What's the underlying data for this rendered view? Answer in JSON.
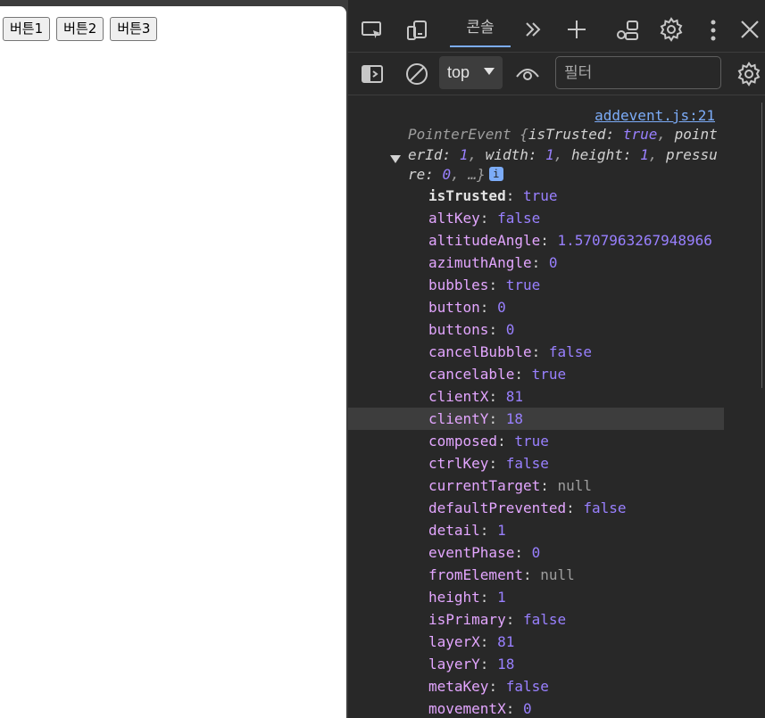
{
  "page": {
    "buttons": [
      {
        "label": "버튼1"
      },
      {
        "label": "버튼2"
      },
      {
        "label": "버튼3"
      }
    ]
  },
  "devtools": {
    "toolbar": {
      "icons": [
        "device-inspect-icon",
        "device-toggle-icon",
        "more-tabs-icon",
        "add-tab-icon",
        "feedback-icon",
        "settings-icon",
        "kebab-menu-icon",
        "close-icon"
      ],
      "active_tab": "콘솔"
    },
    "console_toolbar": {
      "context": "top",
      "filter_placeholder": "필터"
    },
    "console": {
      "source_link": "addevent.js:21",
      "summary": {
        "prefix": "PointerEvent {",
        "fields": [
          {
            "key": "isTrusted",
            "value": "true"
          },
          {
            "key": "pointerId",
            "value": "1"
          },
          {
            "key": "width",
            "value": "1"
          },
          {
            "key": "height",
            "value": "1"
          },
          {
            "key": "pressure",
            "value": "0"
          }
        ],
        "suffix": ", …}",
        "info_badge": "i"
      },
      "properties": [
        {
          "key": "isTrusted",
          "value": "true",
          "type": "bool",
          "own": true
        },
        {
          "key": "altKey",
          "value": "false",
          "type": "bool"
        },
        {
          "key": "altitudeAngle",
          "value": "1.5707963267948966",
          "type": "num"
        },
        {
          "key": "azimuthAngle",
          "value": "0",
          "type": "num"
        },
        {
          "key": "bubbles",
          "value": "true",
          "type": "bool"
        },
        {
          "key": "button",
          "value": "0",
          "type": "num"
        },
        {
          "key": "buttons",
          "value": "0",
          "type": "num"
        },
        {
          "key": "cancelBubble",
          "value": "false",
          "type": "bool"
        },
        {
          "key": "cancelable",
          "value": "true",
          "type": "bool"
        },
        {
          "key": "clientX",
          "value": "81",
          "type": "num"
        },
        {
          "key": "clientY",
          "value": "18",
          "type": "num",
          "highlighted": true
        },
        {
          "key": "composed",
          "value": "true",
          "type": "bool"
        },
        {
          "key": "ctrlKey",
          "value": "false",
          "type": "bool"
        },
        {
          "key": "currentTarget",
          "value": "null",
          "type": "null"
        },
        {
          "key": "defaultPrevented",
          "value": "false",
          "type": "bool"
        },
        {
          "key": "detail",
          "value": "1",
          "type": "num"
        },
        {
          "key": "eventPhase",
          "value": "0",
          "type": "num"
        },
        {
          "key": "fromElement",
          "value": "null",
          "type": "null"
        },
        {
          "key": "height",
          "value": "1",
          "type": "num"
        },
        {
          "key": "isPrimary",
          "value": "false",
          "type": "bool"
        },
        {
          "key": "layerX",
          "value": "81",
          "type": "num"
        },
        {
          "key": "layerY",
          "value": "18",
          "type": "num"
        },
        {
          "key": "metaKey",
          "value": "false",
          "type": "bool"
        },
        {
          "key": "movementX",
          "value": "0",
          "type": "num"
        }
      ]
    }
  },
  "colors": {
    "devtools_bg": "#282828",
    "link": "#7cacf8",
    "value": "#9980ff",
    "key": "#e3a6ff"
  }
}
